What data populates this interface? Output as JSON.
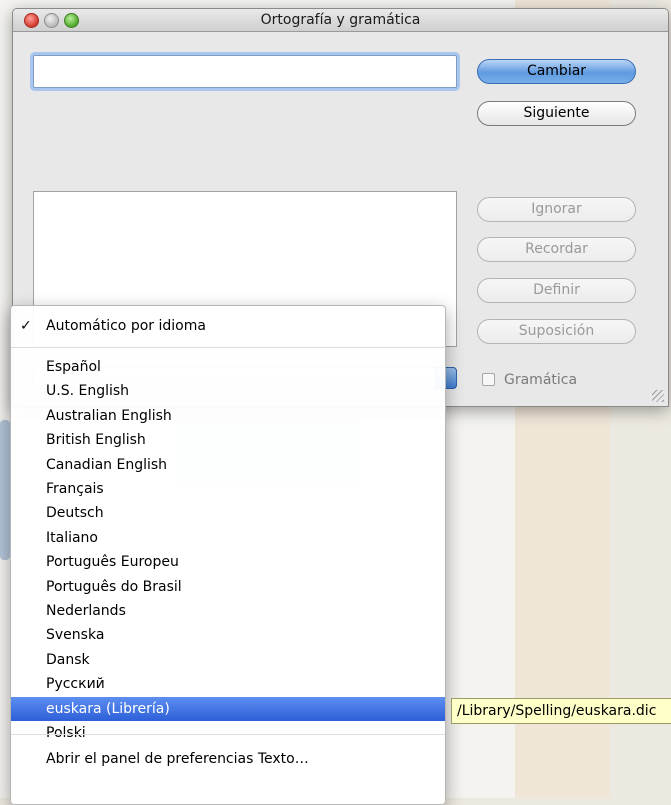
{
  "window": {
    "title": "Ortografía y gramática"
  },
  "buttons": {
    "change": "Cambiar",
    "next": "Siguiente",
    "ignore": "Ignorar",
    "learn": "Recordar",
    "define": "Definir",
    "guess": "Suposición"
  },
  "grammar": {
    "label": "Gramática",
    "checked": false
  },
  "menu": {
    "auto": "Automático por idioma",
    "auto_checked": true,
    "languages": [
      "Español",
      "U.S. English",
      "Australian English",
      "British English",
      "Canadian English",
      "Français",
      "Deutsch",
      "Italiano",
      "Português Europeu",
      "Português do Brasil",
      "Nederlands",
      "Svenska",
      "Dansk",
      "Русский",
      "euskara (Librería)",
      "Polski"
    ],
    "selected": "euskara (Librería)",
    "footer": "Abrir el panel de preferencias Texto…"
  },
  "tooltip": "/Library/Spelling/euskara.dic",
  "colors": {
    "selection": "#2d5fd9",
    "primary_button": "#5f9be0",
    "tooltip_bg": "#ffffc8"
  }
}
